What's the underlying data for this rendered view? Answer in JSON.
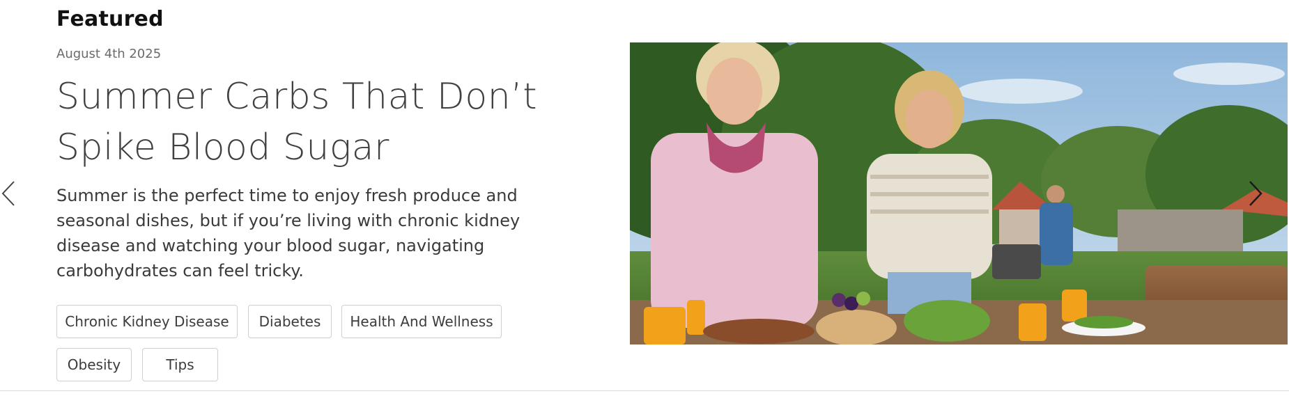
{
  "section": {
    "title": "Featured"
  },
  "article": {
    "date": "August 4th 2025",
    "title": "Summer Carbs That Don’t Spike Blood Sugar",
    "summary": "Summer is the perfect time to enjoy fresh produce and seasonal dishes, but if you’re living with chronic kidney disease and watching your blood sugar, navigating carbohydrates can feel tricky.",
    "tags": [
      "Chronic Kidney Disease",
      "Diabetes",
      "Health And Wellness",
      "Obesity",
      "Tips"
    ]
  },
  "carousel": {
    "prev_icon": "chevron-left-icon",
    "next_icon": "chevron-right-icon"
  },
  "colors": {
    "text": "#404040",
    "muted": "#6b6b6b",
    "tag_border": "#cfcfcf"
  }
}
